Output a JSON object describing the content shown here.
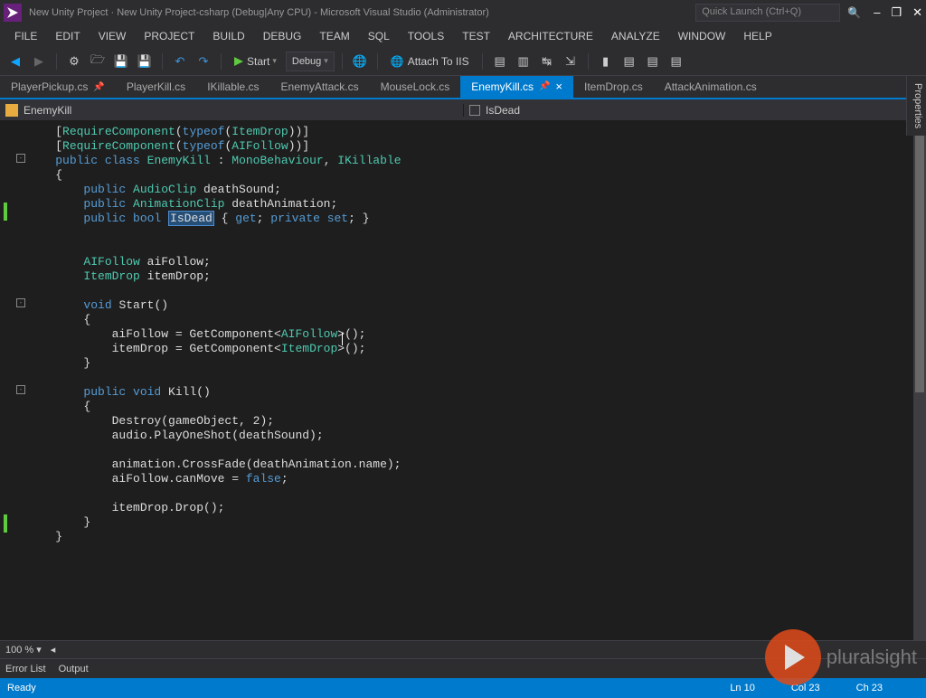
{
  "title": "New Unity Project · New Unity Project-csharp (Debug|Any CPU) - Microsoft Visual Studio (Administrator)",
  "quick_launch_placeholder": "Quick Launch (Ctrl+Q)",
  "menu": [
    "FILE",
    "EDIT",
    "VIEW",
    "PROJECT",
    "BUILD",
    "DEBUG",
    "TEAM",
    "SQL",
    "TOOLS",
    "TEST",
    "ARCHITECTURE",
    "ANALYZE",
    "WINDOW",
    "HELP"
  ],
  "toolbar": {
    "start_label": "Start",
    "config": "Debug",
    "attach": "Attach To IIS"
  },
  "tabs": [
    "PlayerPickup.cs",
    "PlayerKill.cs",
    "IKillable.cs",
    "EnemyAttack.cs",
    "MouseLock.cs",
    "EnemyKill.cs",
    "ItemDrop.cs",
    "AttackAnimation.cs"
  ],
  "active_tab": "EnemyKill.cs",
  "nav": {
    "class": "EnemyKill",
    "member": "IsDead"
  },
  "code_lines": [
    {
      "indent": 1,
      "tokens": [
        {
          "t": "[",
          "c": "p"
        },
        {
          "t": "RequireComponent",
          "c": "type"
        },
        {
          "t": "(",
          "c": "p"
        },
        {
          "t": "typeof",
          "c": "kw"
        },
        {
          "t": "(",
          "c": "p"
        },
        {
          "t": "ItemDrop",
          "c": "type"
        },
        {
          "t": "))]",
          "c": "p"
        }
      ]
    },
    {
      "indent": 1,
      "tokens": [
        {
          "t": "[",
          "c": "p"
        },
        {
          "t": "RequireComponent",
          "c": "type"
        },
        {
          "t": "(",
          "c": "p"
        },
        {
          "t": "typeof",
          "c": "kw"
        },
        {
          "t": "(",
          "c": "p"
        },
        {
          "t": "AIFollow",
          "c": "type"
        },
        {
          "t": "))]",
          "c": "p"
        }
      ]
    },
    {
      "indent": 1,
      "tokens": [
        {
          "t": "public",
          "c": "kw"
        },
        {
          "t": " class ",
          "c": "kw"
        },
        {
          "t": "EnemyKill",
          "c": "type"
        },
        {
          "t": " : ",
          "c": "p"
        },
        {
          "t": "MonoBehaviour",
          "c": "type"
        },
        {
          "t": ", ",
          "c": "p"
        },
        {
          "t": "IKillable",
          "c": "type"
        }
      ]
    },
    {
      "indent": 1,
      "tokens": [
        {
          "t": "{",
          "c": "p"
        }
      ]
    },
    {
      "indent": 2,
      "tokens": [
        {
          "t": "public ",
          "c": "kw"
        },
        {
          "t": "AudioClip",
          "c": "type"
        },
        {
          "t": " deathSound;",
          "c": "p"
        }
      ]
    },
    {
      "indent": 2,
      "tokens": [
        {
          "t": "public ",
          "c": "kw"
        },
        {
          "t": "AnimationClip",
          "c": "type"
        },
        {
          "t": " deathAnimation;",
          "c": "p"
        }
      ]
    },
    {
      "indent": 2,
      "tokens": [
        {
          "t": "public ",
          "c": "kw"
        },
        {
          "t": "bool ",
          "c": "kw"
        },
        {
          "t": "IsDead",
          "c": "sel"
        },
        {
          "t": " { ",
          "c": "p"
        },
        {
          "t": "get",
          "c": "kw"
        },
        {
          "t": "; ",
          "c": "p"
        },
        {
          "t": "private ",
          "c": "kw"
        },
        {
          "t": "set",
          "c": "kw"
        },
        {
          "t": "; }",
          "c": "p"
        }
      ]
    },
    {
      "indent": 0,
      "tokens": []
    },
    {
      "indent": 0,
      "tokens": []
    },
    {
      "indent": 2,
      "tokens": [
        {
          "t": "AIFollow",
          "c": "type"
        },
        {
          "t": " aiFollow;",
          "c": "p"
        }
      ]
    },
    {
      "indent": 2,
      "tokens": [
        {
          "t": "ItemDrop",
          "c": "type"
        },
        {
          "t": " itemDrop;",
          "c": "p"
        }
      ]
    },
    {
      "indent": 0,
      "tokens": []
    },
    {
      "indent": 2,
      "tokens": [
        {
          "t": "void ",
          "c": "kw"
        },
        {
          "t": "Start()",
          "c": "p"
        }
      ]
    },
    {
      "indent": 2,
      "tokens": [
        {
          "t": "{",
          "c": "p"
        }
      ]
    },
    {
      "indent": 3,
      "tokens": [
        {
          "t": "aiFollow = GetComponent<",
          "c": "p"
        },
        {
          "t": "AIFollow",
          "c": "type"
        },
        {
          "t": ">();",
          "c": "p"
        }
      ]
    },
    {
      "indent": 3,
      "tokens": [
        {
          "t": "itemDrop = GetComponent<",
          "c": "p"
        },
        {
          "t": "ItemDrop",
          "c": "type"
        },
        {
          "t": ">();",
          "c": "p"
        }
      ]
    },
    {
      "indent": 2,
      "tokens": [
        {
          "t": "}",
          "c": "p"
        }
      ]
    },
    {
      "indent": 0,
      "tokens": []
    },
    {
      "indent": 2,
      "tokens": [
        {
          "t": "public ",
          "c": "kw"
        },
        {
          "t": "void ",
          "c": "kw"
        },
        {
          "t": "Kill()",
          "c": "p"
        }
      ]
    },
    {
      "indent": 2,
      "tokens": [
        {
          "t": "{",
          "c": "p"
        }
      ]
    },
    {
      "indent": 3,
      "tokens": [
        {
          "t": "Destroy(gameObject, 2);",
          "c": "p"
        }
      ]
    },
    {
      "indent": 3,
      "tokens": [
        {
          "t": "audio.PlayOneShot(deathSound);",
          "c": "p"
        }
      ]
    },
    {
      "indent": 0,
      "tokens": []
    },
    {
      "indent": 3,
      "tokens": [
        {
          "t": "animation.CrossFade(deathAnimation.name);",
          "c": "p"
        }
      ]
    },
    {
      "indent": 3,
      "tokens": [
        {
          "t": "aiFollow.canMove = ",
          "c": "p"
        },
        {
          "t": "false",
          "c": "kw"
        },
        {
          "t": ";",
          "c": "p"
        }
      ]
    },
    {
      "indent": 0,
      "tokens": []
    },
    {
      "indent": 3,
      "tokens": [
        {
          "t": "itemDrop.Drop();",
          "c": "p"
        }
      ]
    },
    {
      "indent": 2,
      "tokens": [
        {
          "t": "}",
          "c": "p"
        }
      ]
    },
    {
      "indent": 1,
      "tokens": [
        {
          "t": "}",
          "c": "p"
        }
      ]
    }
  ],
  "zoom": "100 %",
  "bottom_tabs": [
    "Error List",
    "Output"
  ],
  "status": {
    "ready": "Ready",
    "line": "Ln 10",
    "col": "Col 23",
    "ch": "Ch 23"
  },
  "side_panel": "Properties",
  "watermark": "pluralsight"
}
